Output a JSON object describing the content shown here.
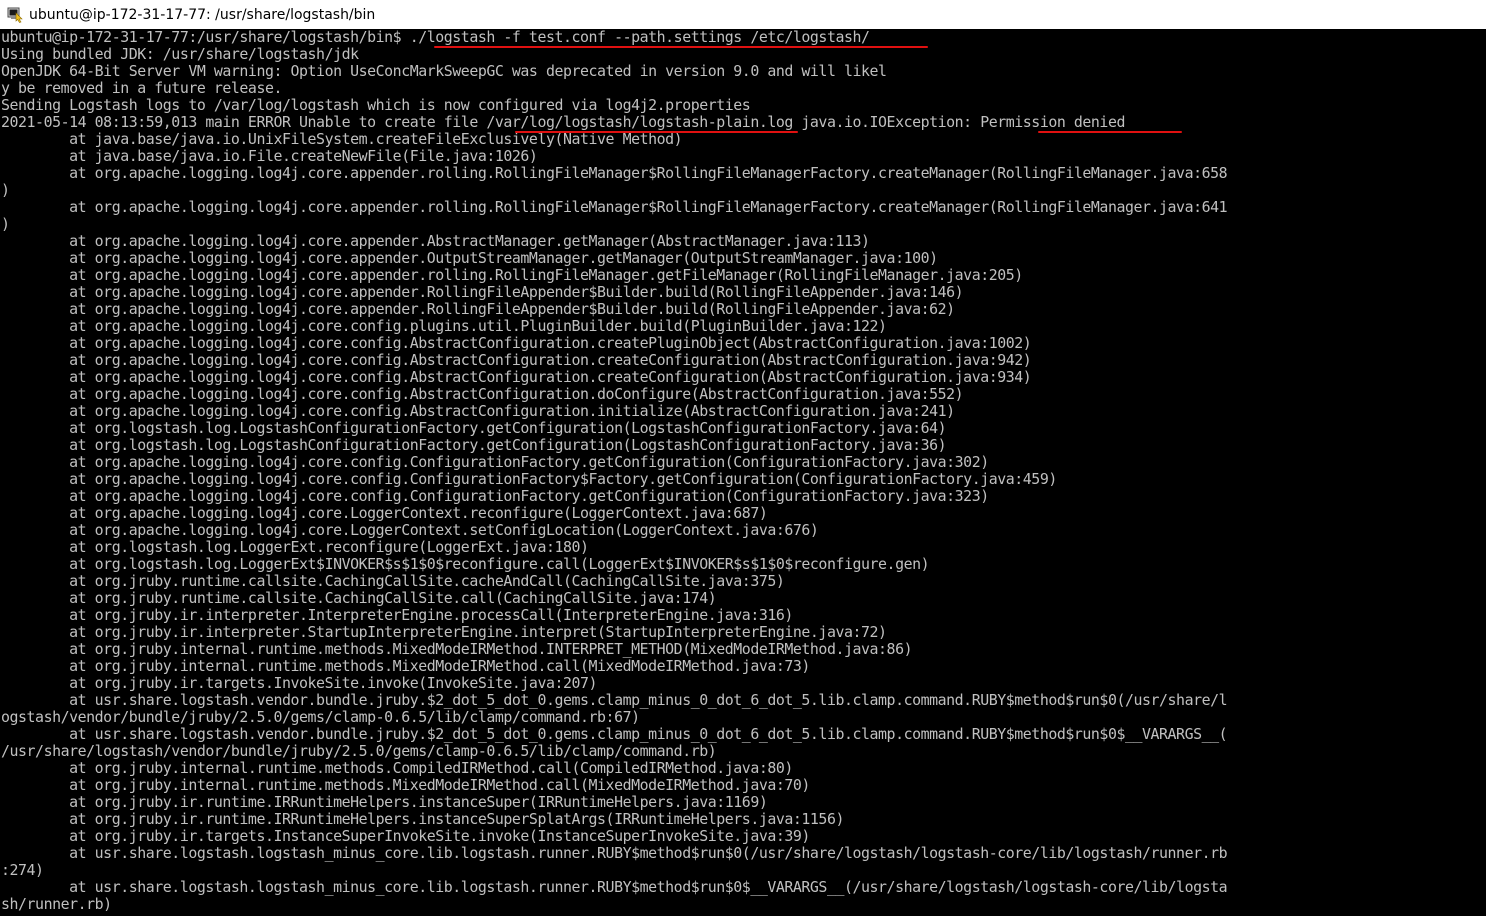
{
  "window": {
    "title": "ubuntu@ip-172-31-17-77: /usr/share/logstash/bin",
    "icon": "putty-terminal-icon"
  },
  "colors": {
    "terminal_bg": "#000000",
    "terminal_fg": "#c0c0c0",
    "annotation": "#e01010"
  },
  "terminal": {
    "lines": [
      "ubuntu@ip-172-31-17-77:/usr/share/logstash/bin$ ./logstash -f test.conf --path.settings /etc/logstash/",
      "Using bundled JDK: /usr/share/logstash/jdk",
      "OpenJDK 64-Bit Server VM warning: Option UseConcMarkSweepGC was deprecated in version 9.0 and will likel",
      "y be removed in a future release.",
      "Sending Logstash logs to /var/log/logstash which is now configured via log4j2.properties",
      "2021-05-14 08:13:59,013 main ERROR Unable to create file /var/log/logstash/logstash-plain.log java.io.IOException: Permission denied",
      "        at java.base/java.io.UnixFileSystem.createFileExclusively(Native Method)",
      "        at java.base/java.io.File.createNewFile(File.java:1026)",
      "        at org.apache.logging.log4j.core.appender.rolling.RollingFileManager$RollingFileManagerFactory.createManager(RollingFileManager.java:658",
      ")",
      "        at org.apache.logging.log4j.core.appender.rolling.RollingFileManager$RollingFileManagerFactory.createManager(RollingFileManager.java:641",
      ")",
      "        at org.apache.logging.log4j.core.appender.AbstractManager.getManager(AbstractManager.java:113)",
      "        at org.apache.logging.log4j.core.appender.OutputStreamManager.getManager(OutputStreamManager.java:100)",
      "        at org.apache.logging.log4j.core.appender.rolling.RollingFileManager.getFileManager(RollingFileManager.java:205)",
      "        at org.apache.logging.log4j.core.appender.RollingFileAppender$Builder.build(RollingFileAppender.java:146)",
      "        at org.apache.logging.log4j.core.appender.RollingFileAppender$Builder.build(RollingFileAppender.java:62)",
      "        at org.apache.logging.log4j.core.config.plugins.util.PluginBuilder.build(PluginBuilder.java:122)",
      "        at org.apache.logging.log4j.core.config.AbstractConfiguration.createPluginObject(AbstractConfiguration.java:1002)",
      "        at org.apache.logging.log4j.core.config.AbstractConfiguration.createConfiguration(AbstractConfiguration.java:942)",
      "        at org.apache.logging.log4j.core.config.AbstractConfiguration.createConfiguration(AbstractConfiguration.java:934)",
      "        at org.apache.logging.log4j.core.config.AbstractConfiguration.doConfigure(AbstractConfiguration.java:552)",
      "        at org.apache.logging.log4j.core.config.AbstractConfiguration.initialize(AbstractConfiguration.java:241)",
      "        at org.logstash.log.LogstashConfigurationFactory.getConfiguration(LogstashConfigurationFactory.java:64)",
      "        at org.logstash.log.LogstashConfigurationFactory.getConfiguration(LogstashConfigurationFactory.java:36)",
      "        at org.apache.logging.log4j.core.config.ConfigurationFactory.getConfiguration(ConfigurationFactory.java:302)",
      "        at org.apache.logging.log4j.core.config.ConfigurationFactory$Factory.getConfiguration(ConfigurationFactory.java:459)",
      "        at org.apache.logging.log4j.core.config.ConfigurationFactory.getConfiguration(ConfigurationFactory.java:323)",
      "        at org.apache.logging.log4j.core.LoggerContext.reconfigure(LoggerContext.java:687)",
      "        at org.apache.logging.log4j.core.LoggerContext.setConfigLocation(LoggerContext.java:676)",
      "        at org.logstash.log.LoggerExt.reconfigure(LoggerExt.java:180)",
      "        at org.logstash.log.LoggerExt$INVOKER$s$1$0$reconfigure.call(LoggerExt$INVOKER$s$1$0$reconfigure.gen)",
      "        at org.jruby.runtime.callsite.CachingCallSite.cacheAndCall(CachingCallSite.java:375)",
      "        at org.jruby.runtime.callsite.CachingCallSite.call(CachingCallSite.java:174)",
      "        at org.jruby.ir.interpreter.InterpreterEngine.processCall(InterpreterEngine.java:316)",
      "        at org.jruby.ir.interpreter.StartupInterpreterEngine.interpret(StartupInterpreterEngine.java:72)",
      "        at org.jruby.internal.runtime.methods.MixedModeIRMethod.INTERPRET_METHOD(MixedModeIRMethod.java:86)",
      "        at org.jruby.internal.runtime.methods.MixedModeIRMethod.call(MixedModeIRMethod.java:73)",
      "        at org.jruby.ir.targets.InvokeSite.invoke(InvokeSite.java:207)",
      "        at usr.share.logstash.vendor.bundle.jruby.$2_dot_5_dot_0.gems.clamp_minus_0_dot_6_dot_5.lib.clamp.command.RUBY$method$run$0(/usr/share/l",
      "ogstash/vendor/bundle/jruby/2.5.0/gems/clamp-0.6.5/lib/clamp/command.rb:67)",
      "        at usr.share.logstash.vendor.bundle.jruby.$2_dot_5_dot_0.gems.clamp_minus_0_dot_6_dot_5.lib.clamp.command.RUBY$method$run$0$__VARARGS__(",
      "/usr/share/logstash/vendor/bundle/jruby/2.5.0/gems/clamp-0.6.5/lib/clamp/command.rb)",
      "        at org.jruby.internal.runtime.methods.CompiledIRMethod.call(CompiledIRMethod.java:80)",
      "        at org.jruby.internal.runtime.methods.MixedModeIRMethod.call(MixedModeIRMethod.java:70)",
      "        at org.jruby.ir.runtime.IRRuntimeHelpers.instanceSuper(IRRuntimeHelpers.java:1169)",
      "        at org.jruby.ir.runtime.IRRuntimeHelpers.instanceSuperSplatArgs(IRRuntimeHelpers.java:1156)",
      "        at org.jruby.ir.targets.InstanceSuperInvokeSite.invoke(InstanceSuperInvokeSite.java:39)",
      "        at usr.share.logstash.logstash_minus_core.lib.logstash.runner.RUBY$method$run$0(/usr/share/logstash/logstash-core/lib/logstash/runner.rb",
      ":274)",
      "        at usr.share.logstash.logstash_minus_core.lib.logstash.runner.RUBY$method$run$0$__VARARGS__(/usr/share/logstash/logstash-core/lib/logsta",
      "sh/runner.rb)"
    ]
  }
}
